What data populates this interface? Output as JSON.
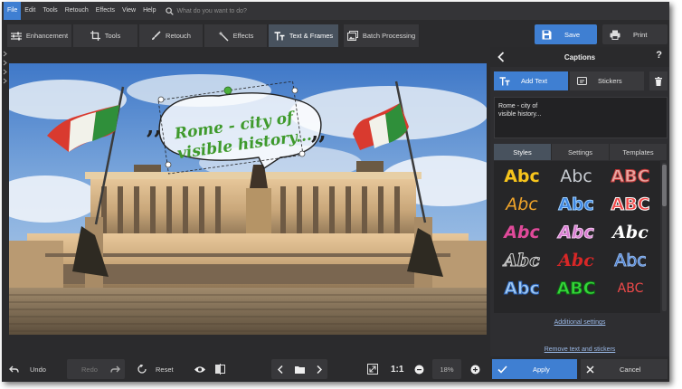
{
  "menu": {
    "items": [
      "File",
      "Edit",
      "Tools",
      "Retouch",
      "Effects",
      "View",
      "Help"
    ],
    "search_placeholder": "What do you want to do?"
  },
  "toolbar": {
    "tabs": [
      "Enhancement",
      "Tools",
      "Retouch",
      "Effects",
      "Text & Frames",
      "Batch Processing"
    ],
    "active_tab": "Text & Frames",
    "save_label": "Save",
    "print_label": "Print"
  },
  "canvas": {
    "caption_line1": "Rome - city of",
    "caption_line2": "visible history..."
  },
  "panel": {
    "title": "Captions",
    "help": "?",
    "add_text_label": "Add Text",
    "stickers_label": "Stickers",
    "caption_text": "Rome - city of\nvisible history...",
    "tabs": [
      "Styles",
      "Settings",
      "Templates"
    ],
    "active_tab": "Styles",
    "style_samples": [
      "Abc",
      "Abc",
      "ABC",
      "Abc",
      "Abc",
      "ABC",
      "Abc",
      "Abc",
      "Abc",
      "Abc",
      "Abc",
      "Abc",
      "Abc",
      "ABC",
      "ABC"
    ],
    "additional_settings": "Additional settings",
    "remove_link": "Remove text and stickers"
  },
  "bottom": {
    "undo": "Undo",
    "redo": "Redo",
    "reset": "Reset",
    "ratio": "1:1",
    "zoom": "18%",
    "apply": "Apply",
    "cancel": "Cancel"
  },
  "colors": {
    "accent": "#3f7fd2",
    "caption_text": "#3f9a2c",
    "handle": "#4caf3c"
  }
}
